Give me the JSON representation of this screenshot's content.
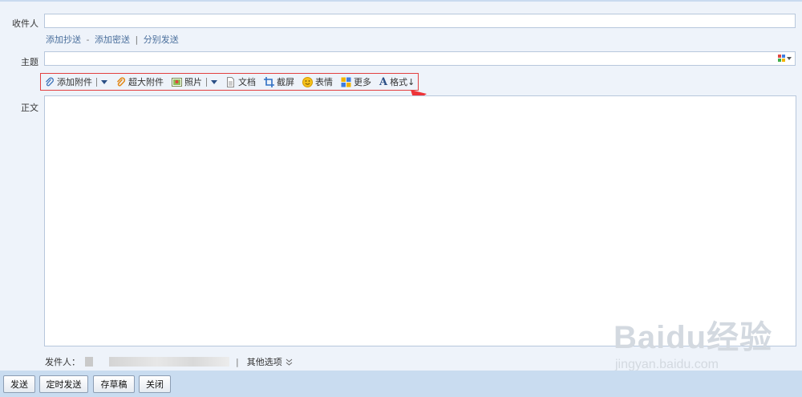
{
  "to": {
    "label": "收件人",
    "value": ""
  },
  "recipient_links": {
    "cc": "添加抄送",
    "dash": "-",
    "bcc": "添加密送",
    "bar": "|",
    "separate": "分别发送"
  },
  "subject": {
    "label": "主题",
    "value": ""
  },
  "toolbar": {
    "attach": "添加附件",
    "large_attach": "超大附件",
    "photo": "照片",
    "doc": "文档",
    "screenshot": "截屏",
    "emoji": "表情",
    "more": "更多",
    "format": "格式↓",
    "format_glyph": "A"
  },
  "body": {
    "label": "正文",
    "value": ""
  },
  "sender": {
    "label": "发件人：",
    "other_options": "其他选项",
    "bar": "|"
  },
  "buttons": {
    "send": "发送",
    "schedule": "定时发送",
    "draft": "存草稿",
    "close": "关闭"
  },
  "watermark": {
    "main": "Baidu经验",
    "sub": "jingyan.baidu.com"
  },
  "colors": {
    "highlight_box": "#e34040",
    "link": "#4a6f9c",
    "footer": "#c9dcf0"
  }
}
